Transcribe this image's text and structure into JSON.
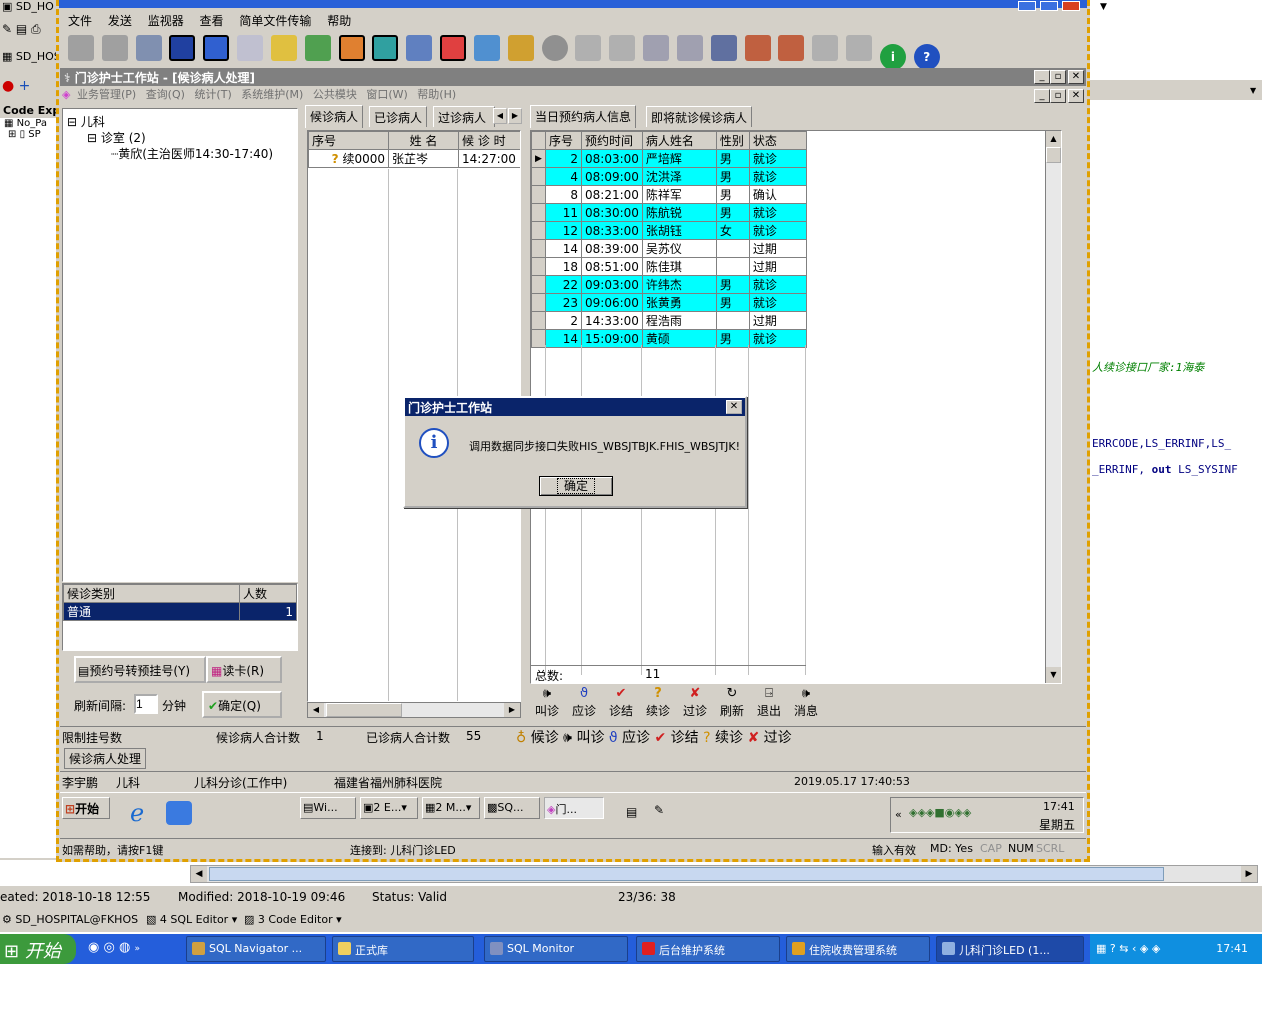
{
  "outer": {
    "left_tree_header": "Code Exp",
    "left_tree_items": [
      "No_Pa",
      "SP"
    ],
    "left_top_labels": [
      "SD_HO",
      "SD_HOS"
    ],
    "code_lines": [
      "人续诊接口厂家:1海泰",
      "ERRCODE,LS_ERRINF,LS_",
      "_ERRINF, out LS_SYSINF"
    ],
    "code_keyword": "out",
    "status": {
      "created": "eated: 2018-10-18 12:55",
      "modified": "Modified: 2018-10-19 09:46",
      "status": "Status: Valid",
      "position": "23/36: 38"
    },
    "connection_bar": {
      "connection": "SD_HOSPITAL@FKHOS",
      "sql_editor": "4 SQL Editor",
      "code_editor": "3 Code Editor"
    }
  },
  "taskbar": {
    "start": "开始",
    "tasks": [
      "SQL Navigator ...",
      "正式库",
      "SQL Monitor",
      "后台维护系统",
      "住院收费管理系统",
      "儿科门诊LED (1..."
    ],
    "clock": "17:41"
  },
  "app": {
    "menu": [
      "文件",
      "发送",
      "监视器",
      "查看",
      "简单文件传输",
      "帮助"
    ],
    "inner_title": "门诊护士工作站 - [候诊病人处理]",
    "inner_menu": [
      "业务管理(P)",
      "查询(Q)",
      "统计(T)",
      "系统维护(M)",
      "公共模块",
      "窗口(W)",
      "帮助(H)"
    ],
    "tree": {
      "root": "儿科",
      "room": "诊室 (2)",
      "doctor": "黄欣(主治医师14:30-17:40)"
    },
    "category_table": {
      "headers": [
        "候诊类别",
        "人数"
      ],
      "rows": [
        {
          "name": "普通",
          "count": "1"
        }
      ]
    },
    "buttons": {
      "transfer": "预约号转预挂号(Y)",
      "read_card": "读卡(R)",
      "refresh_label": "刷新间隔:",
      "refresh_value": "1",
      "refresh_unit": "分钟",
      "confirm": "确定(Q)"
    },
    "mid_tabs": [
      "候诊病人",
      "已诊病人",
      "过诊病人"
    ],
    "waiting_table": {
      "headers": [
        "序号",
        "姓  名",
        "候 诊 时"
      ],
      "rows": [
        {
          "no": "续0000",
          "name": "张芷岑",
          "time": "14:27:00"
        }
      ]
    },
    "right_tabs": [
      "当日预约病人信息",
      "即将就诊候诊病人"
    ],
    "appt_table": {
      "headers": [
        "序号",
        "预约时间",
        "病人姓名",
        "性别",
        "状态"
      ],
      "rows": [
        {
          "no": "2",
          "time": "08:03:00",
          "name": "严培辉",
          "sex": "男",
          "status": "就诊",
          "hl": true
        },
        {
          "no": "4",
          "time": "08:09:00",
          "name": "沈洪泽",
          "sex": "男",
          "status": "就诊",
          "hl": true
        },
        {
          "no": "8",
          "time": "08:21:00",
          "name": "陈祥军",
          "sex": "男",
          "status": "确认",
          "hl": false
        },
        {
          "no": "11",
          "time": "08:30:00",
          "name": "陈航锐",
          "sex": "男",
          "status": "就诊",
          "hl": true
        },
        {
          "no": "12",
          "time": "08:33:00",
          "name": "张胡钰",
          "sex": "女",
          "status": "就诊",
          "hl": true
        },
        {
          "no": "14",
          "time": "08:39:00",
          "name": "吴苏仪",
          "sex": "",
          "status": "过期",
          "hl": false
        },
        {
          "no": "18",
          "time": "08:51:00",
          "name": "陈佳琪",
          "sex": "",
          "status": "过期",
          "hl": false
        },
        {
          "no": "22",
          "time": "09:03:00",
          "name": "许纬杰",
          "sex": "男",
          "status": "就诊",
          "hl": true
        },
        {
          "no": "23",
          "time": "09:06:00",
          "name": "张黄勇",
          "sex": "男",
          "status": "就诊",
          "hl": true
        },
        {
          "no": "2",
          "time": "14:33:00",
          "name": "程浩雨",
          "sex": "",
          "status": "过期",
          "hl": false
        },
        {
          "no": "14",
          "time": "15:09:00",
          "name": "黄硕",
          "sex": "男",
          "status": "就诊",
          "hl": true
        }
      ],
      "footer_label": "总数:",
      "footer_value": "11"
    },
    "action_buttons": [
      "叫诊",
      "应诊",
      "诊结",
      "续诊",
      "过诊",
      "刷新",
      "退出",
      "消息"
    ],
    "summary": {
      "limit_label": "限制挂号数",
      "waiting_total_label": "候诊病人合计数",
      "waiting_total": "1",
      "done_total_label": "已诊病人合计数",
      "done_total": "55"
    },
    "legend": [
      "候诊",
      "叫诊",
      "应诊",
      "诊结",
      "续诊",
      "过诊"
    ],
    "window_tab": "候诊病人处理",
    "statusbar": {
      "user": "李宇鹏",
      "dept": "儿科",
      "room": "儿科分诊(工作中)",
      "hospital": "福建省福州肺科医院",
      "datetime": "2019.05.17 17:40:53"
    },
    "inner_taskbar": {
      "start": "开始",
      "tasks": [
        "Wi...",
        "2 E...",
        "2 M...",
        "SQ...",
        "门..."
      ],
      "clock": "17:41",
      "day": "星期五"
    },
    "help_status": {
      "help": "如需帮助，请按F1键",
      "connected": "连接到: 儿科门诊LED",
      "input": "输入有效",
      "md": "MD: Yes",
      "cap": "CAP",
      "num": "NUM",
      "scrl": "SCRL"
    }
  },
  "dialog": {
    "title": "门诊护士工作站",
    "message": "调用数据同步接口失败HIS_WBSJTBJK.FHIS_WBSJTJK!",
    "ok": "确定"
  }
}
